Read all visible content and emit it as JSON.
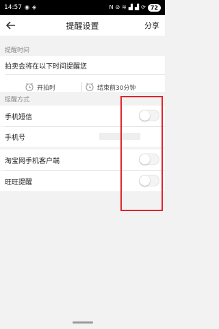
{
  "status_bar": {
    "time": "14:57",
    "battery": "72"
  },
  "nav": {
    "title": "提醒设置",
    "share_label": "分享"
  },
  "reminder_time": {
    "section_label": "提醒时间",
    "hint": "拍卖会将在以下时间提醒您",
    "options": [
      {
        "label": "开拍时",
        "icon": "alarm-clock-icon"
      },
      {
        "label": "结束前30分钟",
        "icon": "alarm-clock-icon"
      }
    ]
  },
  "reminder_method": {
    "section_label": "提醒方式",
    "rows": [
      {
        "label": "手机短信",
        "type": "toggle",
        "on": false
      },
      {
        "label": "手机号",
        "type": "value"
      },
      {
        "label": "淘宝网手机客户端",
        "type": "toggle",
        "on": false
      },
      {
        "label": "旺旺提醒",
        "type": "toggle",
        "on": false
      }
    ]
  },
  "colors": {
    "highlight_box": "#e0242a",
    "background": "#f2f2f2"
  }
}
